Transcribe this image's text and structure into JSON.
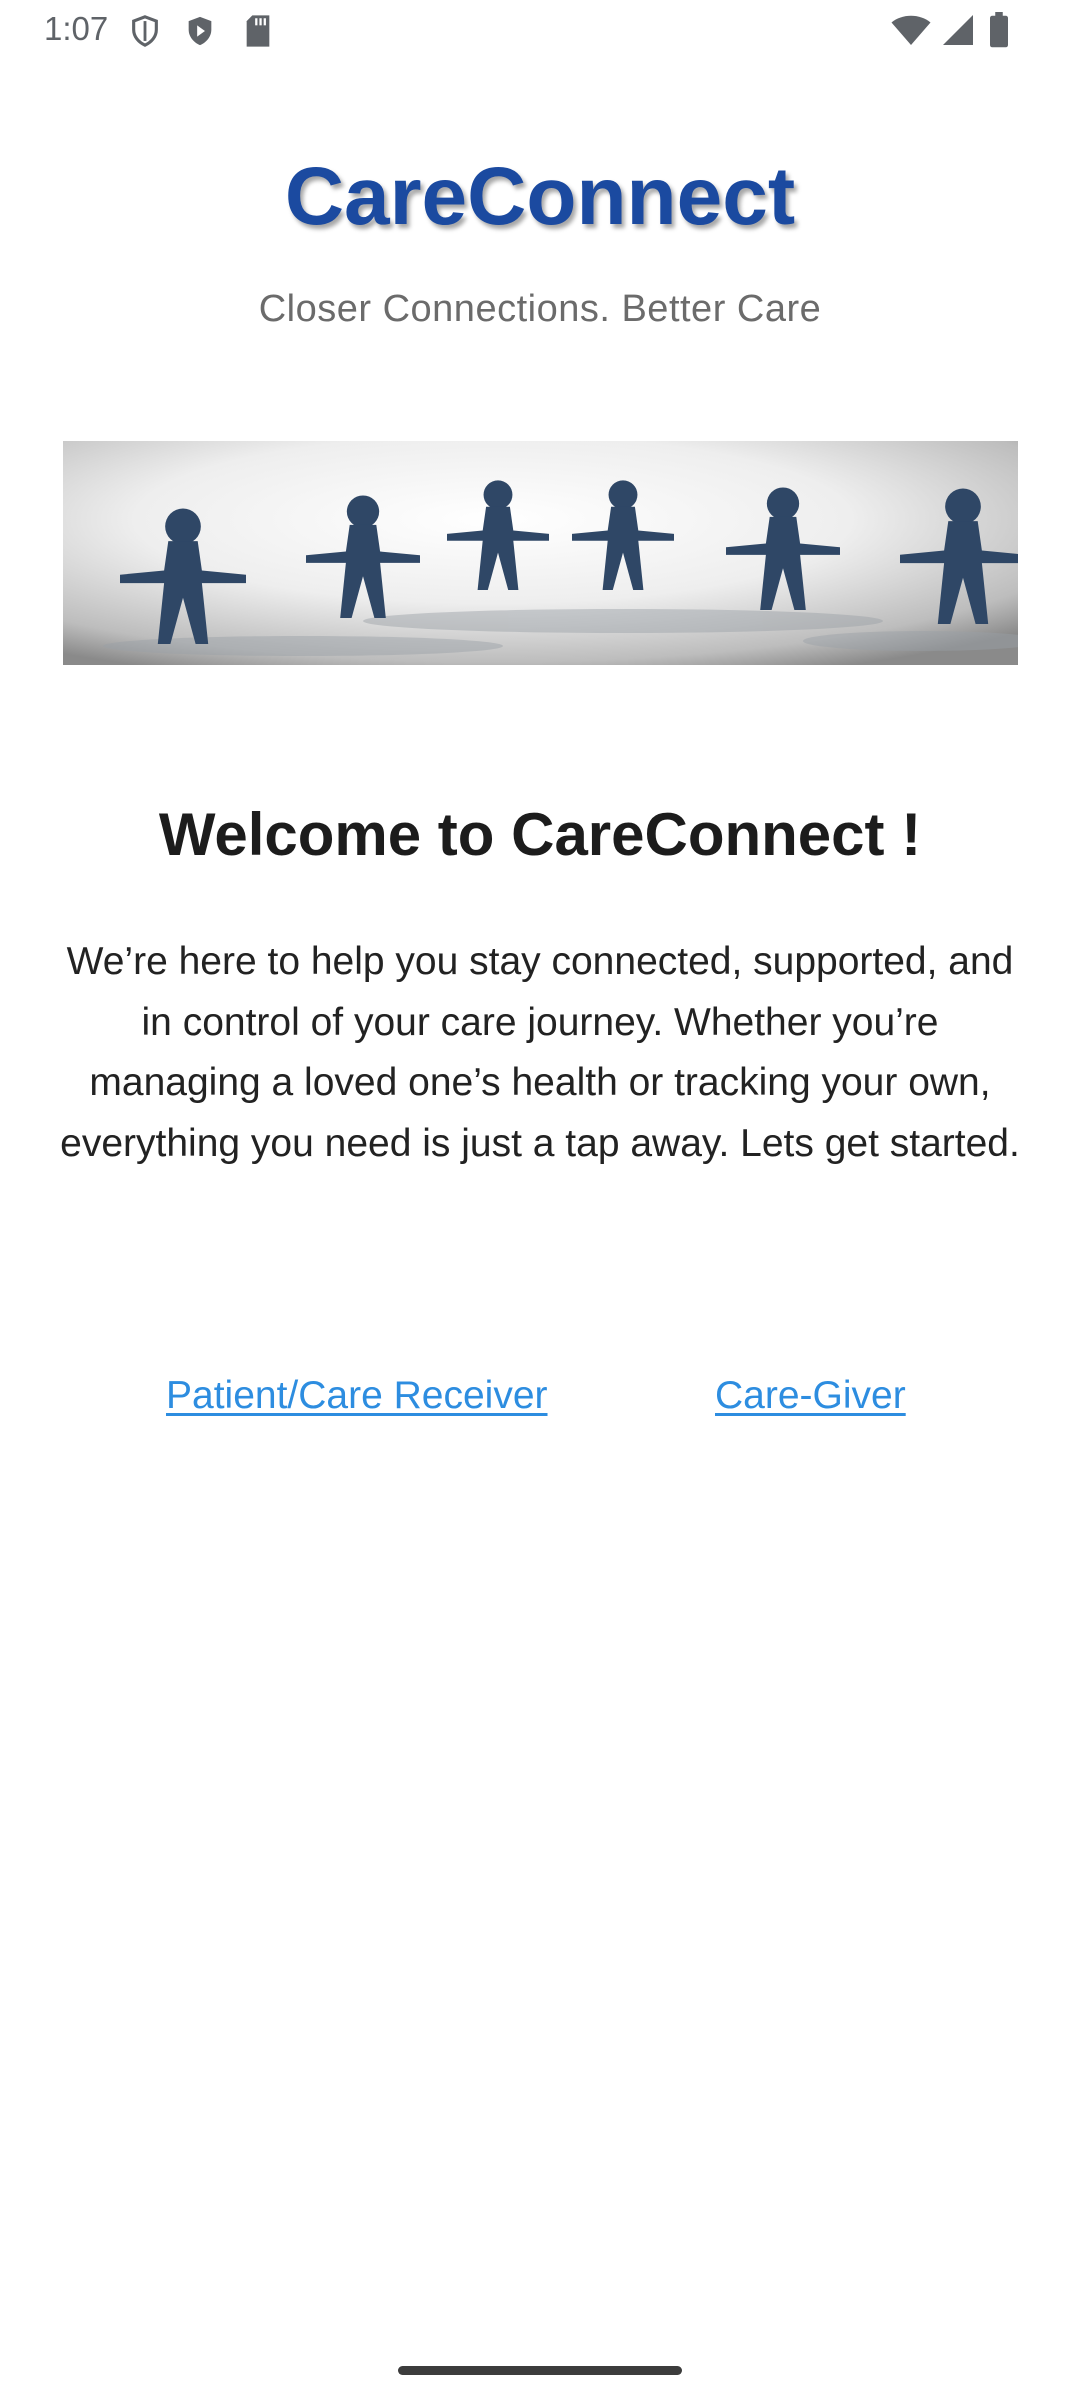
{
  "status_bar": {
    "time": "1:07",
    "left_icons": [
      "shield-outline-icon",
      "play-shield-icon",
      "sd-card-icon"
    ],
    "right_icons": [
      "wifi-icon",
      "cell-signal-icon",
      "battery-icon"
    ]
  },
  "header": {
    "title": "CareConnect",
    "tagline": "Closer Connections. Better Care"
  },
  "banner": {
    "description_icon": "paper-people-chain-image"
  },
  "welcome": {
    "title": "Welcome to CareConnect !",
    "body": "We’re here to help you stay connected, supported, and in control of your care journey. Whether you’re managing a loved one’s health or tracking your own, everything you need is just a tap away. Lets get started."
  },
  "roles": {
    "patient_label": "Patient/Care Receiver",
    "caregiver_label": "Care-Giver"
  },
  "colors": {
    "title": "#1b4aa0",
    "link": "#2d8de0",
    "tagline": "#6b6b6b",
    "body_text": "#222222"
  }
}
